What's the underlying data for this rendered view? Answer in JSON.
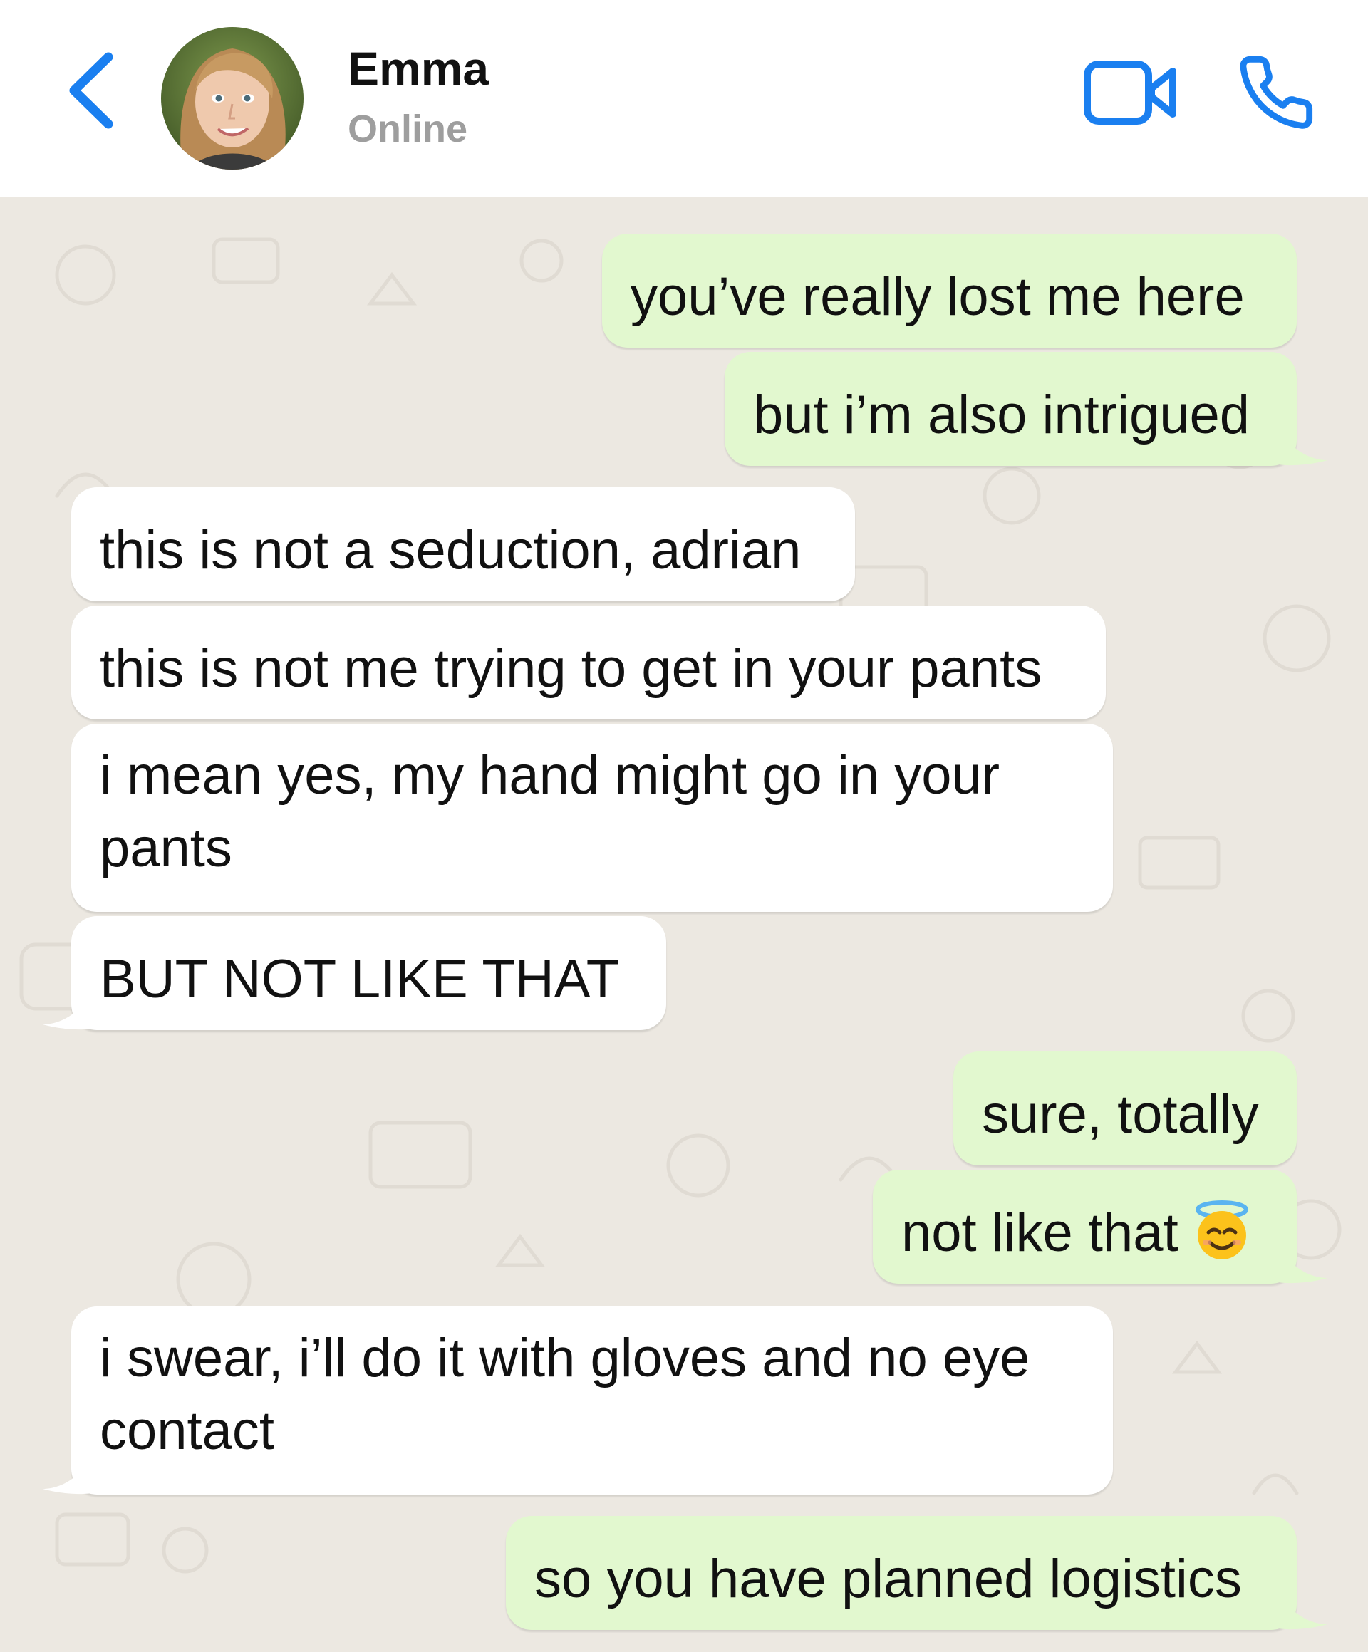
{
  "header": {
    "contact_name": "Emma",
    "contact_status": "Online",
    "back_icon": "chevron-left-icon",
    "video_icon": "video-camera-icon",
    "call_icon": "phone-icon",
    "accent_color": "#1a7ff0"
  },
  "chat": {
    "background_color": "#ece8e1",
    "outgoing_bubble_color": "#e2f8cf",
    "incoming_bubble_color": "#ffffff",
    "messages": [
      {
        "direction": "outgoing",
        "text": "you’ve really lost me here"
      },
      {
        "direction": "outgoing",
        "text": "but i’m also intrigued"
      },
      {
        "direction": "incoming",
        "text": "this is not a seduction, adrian"
      },
      {
        "direction": "incoming",
        "text": "this is not me trying to get in your pants"
      },
      {
        "direction": "incoming",
        "text": "i mean yes, my hand might go in your pants"
      },
      {
        "direction": "incoming",
        "text": "BUT NOT LIKE THAT"
      },
      {
        "direction": "outgoing",
        "text": "sure, totally"
      },
      {
        "direction": "outgoing",
        "text": "not like that",
        "emoji": "smiling-face-with-halo"
      },
      {
        "direction": "incoming",
        "text": "i swear, i’ll do it with gloves and no eye contact"
      },
      {
        "direction": "outgoing",
        "text": "so you have planned logistics"
      }
    ]
  }
}
